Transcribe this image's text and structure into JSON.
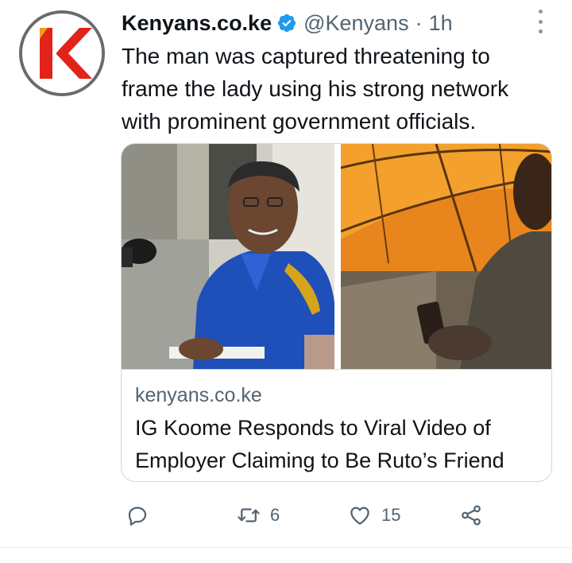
{
  "tweet": {
    "display_name": "Kenyans.co.ke",
    "verified": true,
    "handle": "@Kenyans",
    "separator": "·",
    "time": "1h",
    "text": "The man was captured threatening to frame the lady using his strong network with prominent government officials.",
    "avatar_icon": "kenyans-logo",
    "more_icon": "more-vertical-icon"
  },
  "card": {
    "domain": "kenyans.co.ke",
    "title": "IG Koome Responds to Viral Video of Employer Claiming to Be Ruto’s Friend",
    "images": [
      "police-officer-photo",
      "video-still-photo"
    ]
  },
  "actions": {
    "reply": {
      "icon": "reply-icon",
      "count": ""
    },
    "retweet": {
      "icon": "retweet-icon",
      "count": "6"
    },
    "like": {
      "icon": "heart-icon",
      "count": "15"
    },
    "share": {
      "icon": "share-icon"
    }
  },
  "colors": {
    "verified_blue": "#1d9bf0",
    "secondary_text": "#536471",
    "brand_red": "#e2231a"
  }
}
